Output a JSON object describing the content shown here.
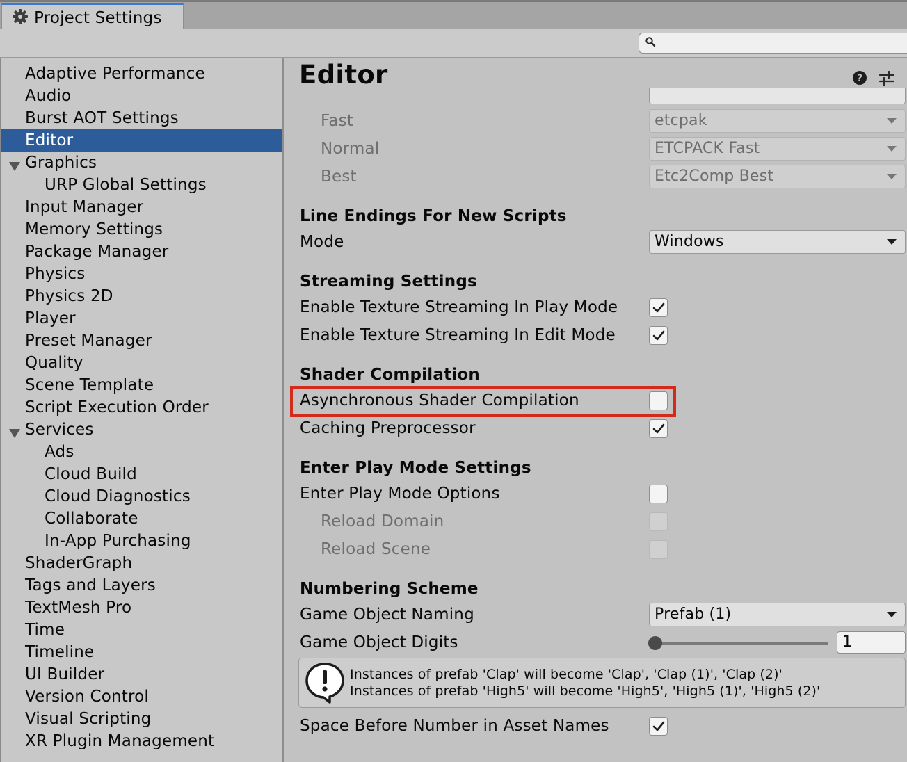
{
  "window": {
    "tab_title": "Project Settings",
    "tab_icon": "gear-icon"
  },
  "toolbar": {
    "search_value": "",
    "search_icon": "magnifier-icon"
  },
  "sidebar": {
    "selected": "Editor",
    "items": [
      {
        "label": "Adaptive Performance",
        "level": 0
      },
      {
        "label": "Audio",
        "level": 0
      },
      {
        "label": "Burst AOT Settings",
        "level": 0
      },
      {
        "label": "Editor",
        "level": 0,
        "selected": true
      },
      {
        "label": "Graphics",
        "level": 0,
        "expanded": true
      },
      {
        "label": "URP Global Settings",
        "level": 1
      },
      {
        "label": "Input Manager",
        "level": 0
      },
      {
        "label": "Memory Settings",
        "level": 0
      },
      {
        "label": "Package Manager",
        "level": 0
      },
      {
        "label": "Physics",
        "level": 0
      },
      {
        "label": "Physics 2D",
        "level": 0
      },
      {
        "label": "Player",
        "level": 0
      },
      {
        "label": "Preset Manager",
        "level": 0
      },
      {
        "label": "Quality",
        "level": 0
      },
      {
        "label": "Scene Template",
        "level": 0
      },
      {
        "label": "Script Execution Order",
        "level": 0
      },
      {
        "label": "Services",
        "level": 0,
        "expanded": true
      },
      {
        "label": "Ads",
        "level": 1
      },
      {
        "label": "Cloud Build",
        "level": 1
      },
      {
        "label": "Cloud Diagnostics",
        "level": 1
      },
      {
        "label": "Collaborate",
        "level": 1
      },
      {
        "label": "In-App Purchasing",
        "level": 1
      },
      {
        "label": "ShaderGraph",
        "level": 0
      },
      {
        "label": "Tags and Layers",
        "level": 0
      },
      {
        "label": "TextMesh Pro",
        "level": 0
      },
      {
        "label": "Time",
        "level": 0
      },
      {
        "label": "Timeline",
        "level": 0
      },
      {
        "label": "UI Builder",
        "level": 0
      },
      {
        "label": "Version Control",
        "level": 0
      },
      {
        "label": "Visual Scripting",
        "level": 0
      },
      {
        "label": "XR Plugin Management",
        "level": 0
      }
    ]
  },
  "main": {
    "title": "Editor",
    "compression": {
      "fast_label": "Fast",
      "fast_value": "etcpak",
      "normal_label": "Normal",
      "normal_value": "ETCPACK Fast",
      "best_label": "Best",
      "best_value": "Etc2Comp Best"
    },
    "line_endings": {
      "header": "Line Endings For New Scripts",
      "mode_label": "Mode",
      "mode_value": "Windows"
    },
    "streaming": {
      "header": "Streaming Settings",
      "play_mode_label": "Enable Texture Streaming In Play Mode",
      "play_mode_checked": true,
      "edit_mode_label": "Enable Texture Streaming In Edit Mode",
      "edit_mode_checked": true
    },
    "shader": {
      "header": "Shader Compilation",
      "async_label": "Asynchronous Shader Compilation",
      "async_checked": false,
      "caching_label": "Caching Preprocessor",
      "caching_checked": true
    },
    "play_mode": {
      "header": "Enter Play Mode Settings",
      "options_label": "Enter Play Mode Options",
      "options_checked": false,
      "reload_domain_label": "Reload Domain",
      "reload_scene_label": "Reload Scene"
    },
    "numbering": {
      "header": "Numbering Scheme",
      "naming_label": "Game Object Naming",
      "naming_value": "Prefab (1)",
      "digits_label": "Game Object Digits",
      "digits_value": "1",
      "help_line1": "Instances of prefab 'Clap' will become 'Clap', 'Clap (1)', 'Clap (2)'",
      "help_line2": "Instances of prefab 'High5' will become 'High5', 'High5 (1)', 'High5 (2)'",
      "space_label": "Space Before Number in Asset Names",
      "space_checked": true
    }
  },
  "colors": {
    "selection": "#2c5d9a",
    "highlight_box": "#d42a1c",
    "tab_accent": "#3a79d2"
  }
}
